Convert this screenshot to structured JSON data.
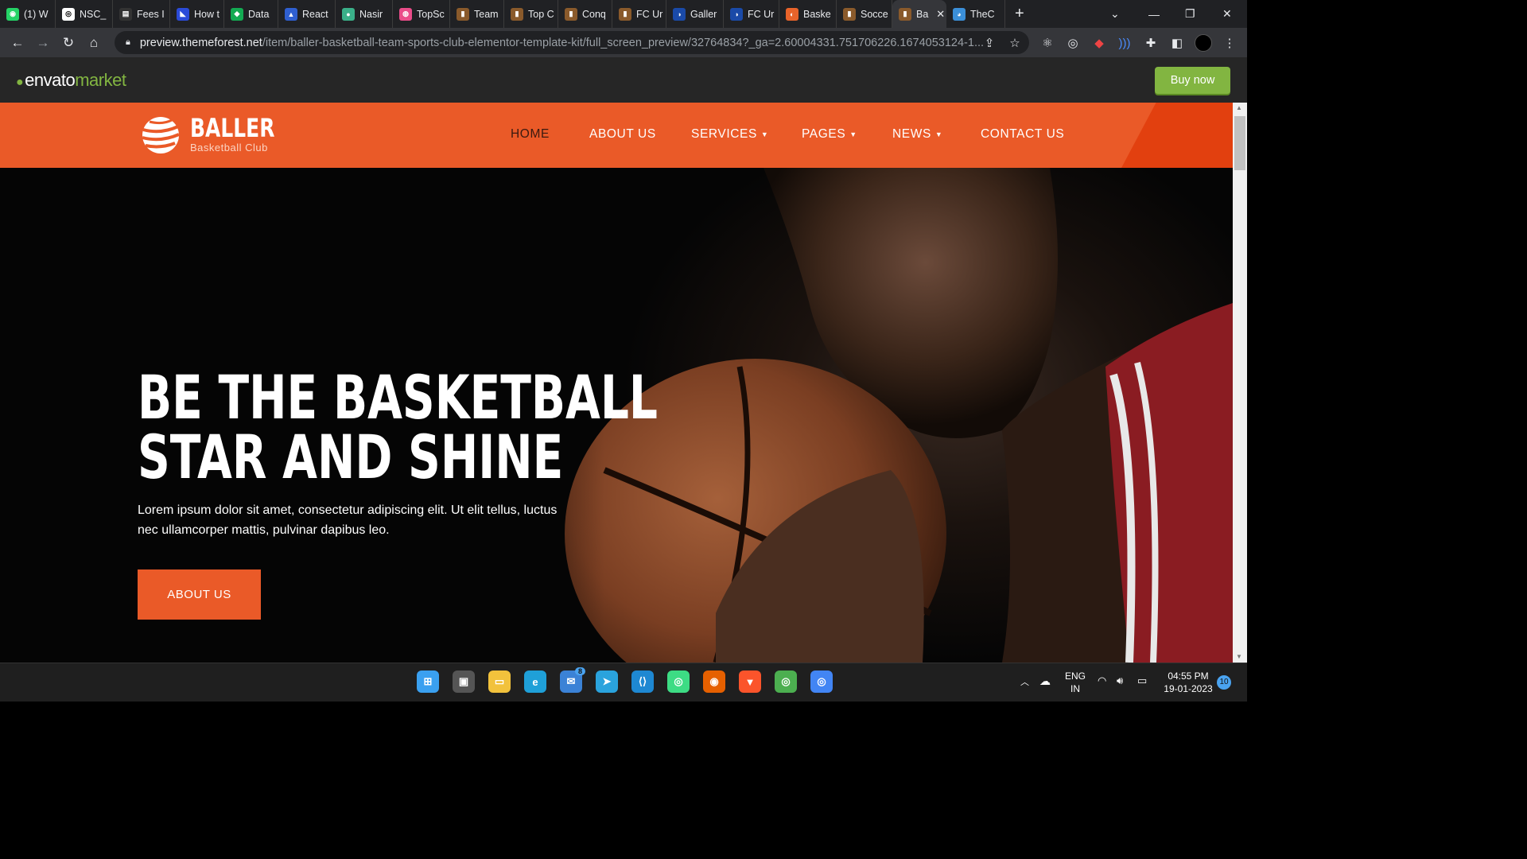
{
  "browser": {
    "tabs": [
      {
        "label": "(1) W",
        "color": "#25d366",
        "glyph": "◉"
      },
      {
        "label": "NSC_",
        "color": "#ffffff",
        "glyph": "◎"
      },
      {
        "label": "Fees I",
        "color": "#333333",
        "glyph": "▤"
      },
      {
        "label": "How t",
        "color": "#2b4bd8",
        "glyph": "◣"
      },
      {
        "label": "Data",
        "color": "#13aa52",
        "glyph": "◆"
      },
      {
        "label": "React",
        "color": "#2f5fd0",
        "glyph": "▲"
      },
      {
        "label": "Nasir",
        "color": "#3ab089",
        "glyph": "●"
      },
      {
        "label": "TopSc",
        "color": "#ea4c89",
        "glyph": "◍"
      },
      {
        "label": "Team",
        "color": "#8a5a2b",
        "glyph": "▮"
      },
      {
        "label": "Top C",
        "color": "#8a5a2b",
        "glyph": "▮"
      },
      {
        "label": "Conq",
        "color": "#8a5a2b",
        "glyph": "▮"
      },
      {
        "label": "FC Ur",
        "color": "#8a5a2b",
        "glyph": "▮"
      },
      {
        "label": "Galler",
        "color": "#1a4aa8",
        "glyph": "◑"
      },
      {
        "label": "FC Ur",
        "color": "#1a4aa8",
        "glyph": "◑"
      },
      {
        "label": "Baske",
        "color": "#e8632a",
        "glyph": "◐"
      },
      {
        "label": "Socce",
        "color": "#8a5a2b",
        "glyph": "▮"
      },
      {
        "label": "Ba",
        "color": "#8a5a2b",
        "glyph": "▮",
        "active": true
      },
      {
        "label": "TheC",
        "color": "#3b8fd8",
        "glyph": "◕"
      }
    ],
    "close_tab": "✕",
    "new_tab": "+",
    "window_controls": {
      "dropdown": "⌄",
      "minimize": "—",
      "restore": "❐",
      "close": "✕"
    },
    "url_host": "preview.themeforest.net",
    "url_path": "/item/baller-basketball-team-sports-club-elementor-template-kit/full_screen_preview/32764834?_ga=2.60004331.751706226.1674053124-1..."
  },
  "envato": {
    "logo_main": "envato",
    "logo_market": "market",
    "buy_now": "Buy now"
  },
  "site": {
    "brand": "BALLER",
    "brand_sub": "Basketball Club",
    "menu": [
      {
        "label": "HOME",
        "active": true,
        "dropdown": false
      },
      {
        "label": "ABOUT US",
        "dropdown": false
      },
      {
        "label": "SERVICES",
        "dropdown": true
      },
      {
        "label": "PAGES",
        "dropdown": true
      },
      {
        "label": "NEWS",
        "dropdown": true
      },
      {
        "label": "CONTACT US",
        "dropdown": false
      }
    ],
    "hero": {
      "title_line1": "BE THE BASKETBALL",
      "title_line2": "STAR AND SHINE",
      "text": "Lorem ipsum dolor sit amet, consectetur adipiscing elit. Ut elit tellus, luctus nec ullamcorper mattis, pulvinar dapibus leo.",
      "button": "ABOUT US"
    },
    "accent": "#ea5a28"
  },
  "taskbar": {
    "apps": [
      {
        "name": "windows-start",
        "color": "#3aa0f0",
        "glyph": "⊞"
      },
      {
        "name": "task-view",
        "color": "#555555",
        "glyph": "▣"
      },
      {
        "name": "file-explorer",
        "color": "#f2c23c",
        "glyph": "▭"
      },
      {
        "name": "edge",
        "color": "#1fa0d8",
        "glyph": "e"
      },
      {
        "name": "mail",
        "color": "#3b82d6",
        "glyph": "✉",
        "badge": "8"
      },
      {
        "name": "telegram",
        "color": "#2aa3dd",
        "glyph": "➤"
      },
      {
        "name": "vscode",
        "color": "#1e88d2",
        "glyph": "⟨⟩"
      },
      {
        "name": "android-studio",
        "color": "#3ddc84",
        "glyph": "◎"
      },
      {
        "name": "firefox",
        "color": "#e66000",
        "glyph": "◉"
      },
      {
        "name": "brave",
        "color": "#fb542b",
        "glyph": "▼"
      },
      {
        "name": "chrome",
        "color": "#4caf50",
        "glyph": "◎"
      },
      {
        "name": "chrome-active",
        "color": "#4285f4",
        "glyph": "◎"
      }
    ],
    "lang": "ENG",
    "region": "IN",
    "time": "04:55 PM",
    "date": "19-01-2023",
    "notifications": "10"
  }
}
